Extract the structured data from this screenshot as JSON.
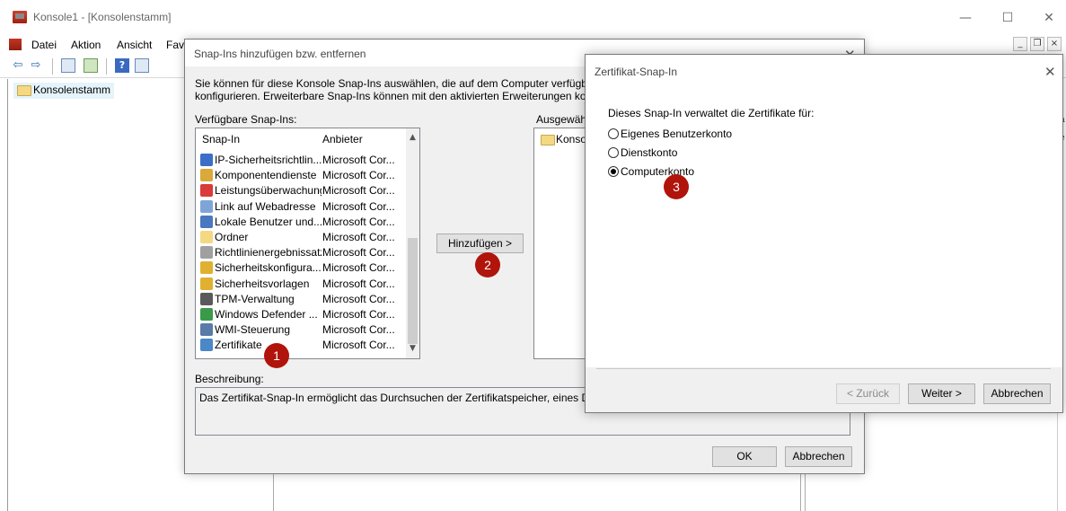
{
  "window": {
    "title": "Konsole1 - [Konsolenstamm]",
    "minimize": "—",
    "maximize": "☐",
    "close": "✕"
  },
  "menu": {
    "items": [
      "Datei",
      "Aktion",
      "Ansicht",
      "Fav"
    ],
    "mdi": {
      "minimize": "_",
      "restore": "❐",
      "close": "×"
    }
  },
  "toolbar": {
    "back": "⇦",
    "forward": "⇨",
    "icons": [
      "console-tree-icon",
      "export-icon",
      "help-icon",
      "action-pane-icon"
    ]
  },
  "tree": {
    "root": "Konsolenstamm"
  },
  "right_strip": {
    "labels": [
      "a",
      "e"
    ]
  },
  "snapins_dialog": {
    "title": "Snap-Ins hinzufügen bzw. entfernen",
    "close": "✕",
    "intro_line1": "Sie können für diese Konsole Snap-Ins auswählen, die auf dem Computer verfügbar sind,",
    "intro_line2": "konfigurieren. Erweiterbare Snap-Ins können mit den aktivierten Erweiterungen konfiguri",
    "available_label": "Verfügbare Snap-Ins:",
    "selected_label": "Ausgewähl",
    "columns": {
      "snapin": "Snap-In",
      "vendor": "Anbieter"
    },
    "rows": [
      {
        "name": "IP-Sicherheitsrichtlin...",
        "vendor": "Microsoft Cor...",
        "icon": "ip-security-icon",
        "color": "#3a6ec8"
      },
      {
        "name": "Komponentendienste",
        "vendor": "Microsoft Cor...",
        "icon": "component-services-icon",
        "color": "#d9a93a"
      },
      {
        "name": "Leistungsüberwachung",
        "vendor": "Microsoft Cor...",
        "icon": "performance-monitor-icon",
        "color": "#d93a3a"
      },
      {
        "name": "Link auf Webadresse",
        "vendor": "Microsoft Cor...",
        "icon": "web-link-icon",
        "color": "#7fa5d8"
      },
      {
        "name": "Lokale Benutzer und...",
        "vendor": "Microsoft Cor...",
        "icon": "local-users-icon",
        "color": "#4a78c0"
      },
      {
        "name": "Ordner",
        "vendor": "Microsoft Cor...",
        "icon": "folder-icon",
        "color": "#f5d882"
      },
      {
        "name": "Richtlinienergebnissatz",
        "vendor": "Microsoft Cor...",
        "icon": "policy-result-icon",
        "color": "#a0a0a0"
      },
      {
        "name": "Sicherheitskonfigura...",
        "vendor": "Microsoft Cor...",
        "icon": "security-config-icon",
        "color": "#e0b030"
      },
      {
        "name": "Sicherheitsvorlagen",
        "vendor": "Microsoft Cor...",
        "icon": "security-templates-icon",
        "color": "#e0b030"
      },
      {
        "name": "TPM-Verwaltung",
        "vendor": "Microsoft Cor...",
        "icon": "tpm-icon",
        "color": "#5a5a5a"
      },
      {
        "name": "Windows Defender ...",
        "vendor": "Microsoft Cor...",
        "icon": "defender-icon",
        "color": "#3a9a4a"
      },
      {
        "name": "WMI-Steuerung",
        "vendor": "Microsoft Cor...",
        "icon": "wmi-icon",
        "color": "#5a7aa8"
      },
      {
        "name": "Zertifikate",
        "vendor": "Microsoft Cor...",
        "icon": "certificates-icon",
        "color": "#4a88c8"
      }
    ],
    "scroll_up": "▲",
    "scroll_down": "▼",
    "add_button": "Hinzufügen >",
    "selected_root": "Konsol",
    "description_label": "Beschreibung:",
    "description_text": "Das Zertifikat-Snap-In ermöglicht das Durchsuchen der Zertifikatspeicher, eines Dienste",
    "ok": "OK",
    "cancel": "Abbrechen"
  },
  "cert_dialog": {
    "title": "Zertifikat-Snap-In",
    "close": "✕",
    "prompt": "Dieses Snap-In verwaltet die Zertifikate für:",
    "options": [
      {
        "label": "Eigenes Benutzerkonto",
        "checked": false
      },
      {
        "label": "Dienstkonto",
        "checked": false
      },
      {
        "label": "Computerkonto",
        "checked": true
      }
    ],
    "back": "< Zurück",
    "next": "Weiter >",
    "cancel": "Abbrechen"
  },
  "badges": [
    "1",
    "2",
    "3"
  ],
  "colors": {
    "badge": "#b0140b",
    "selection": "#e5f3fb"
  }
}
